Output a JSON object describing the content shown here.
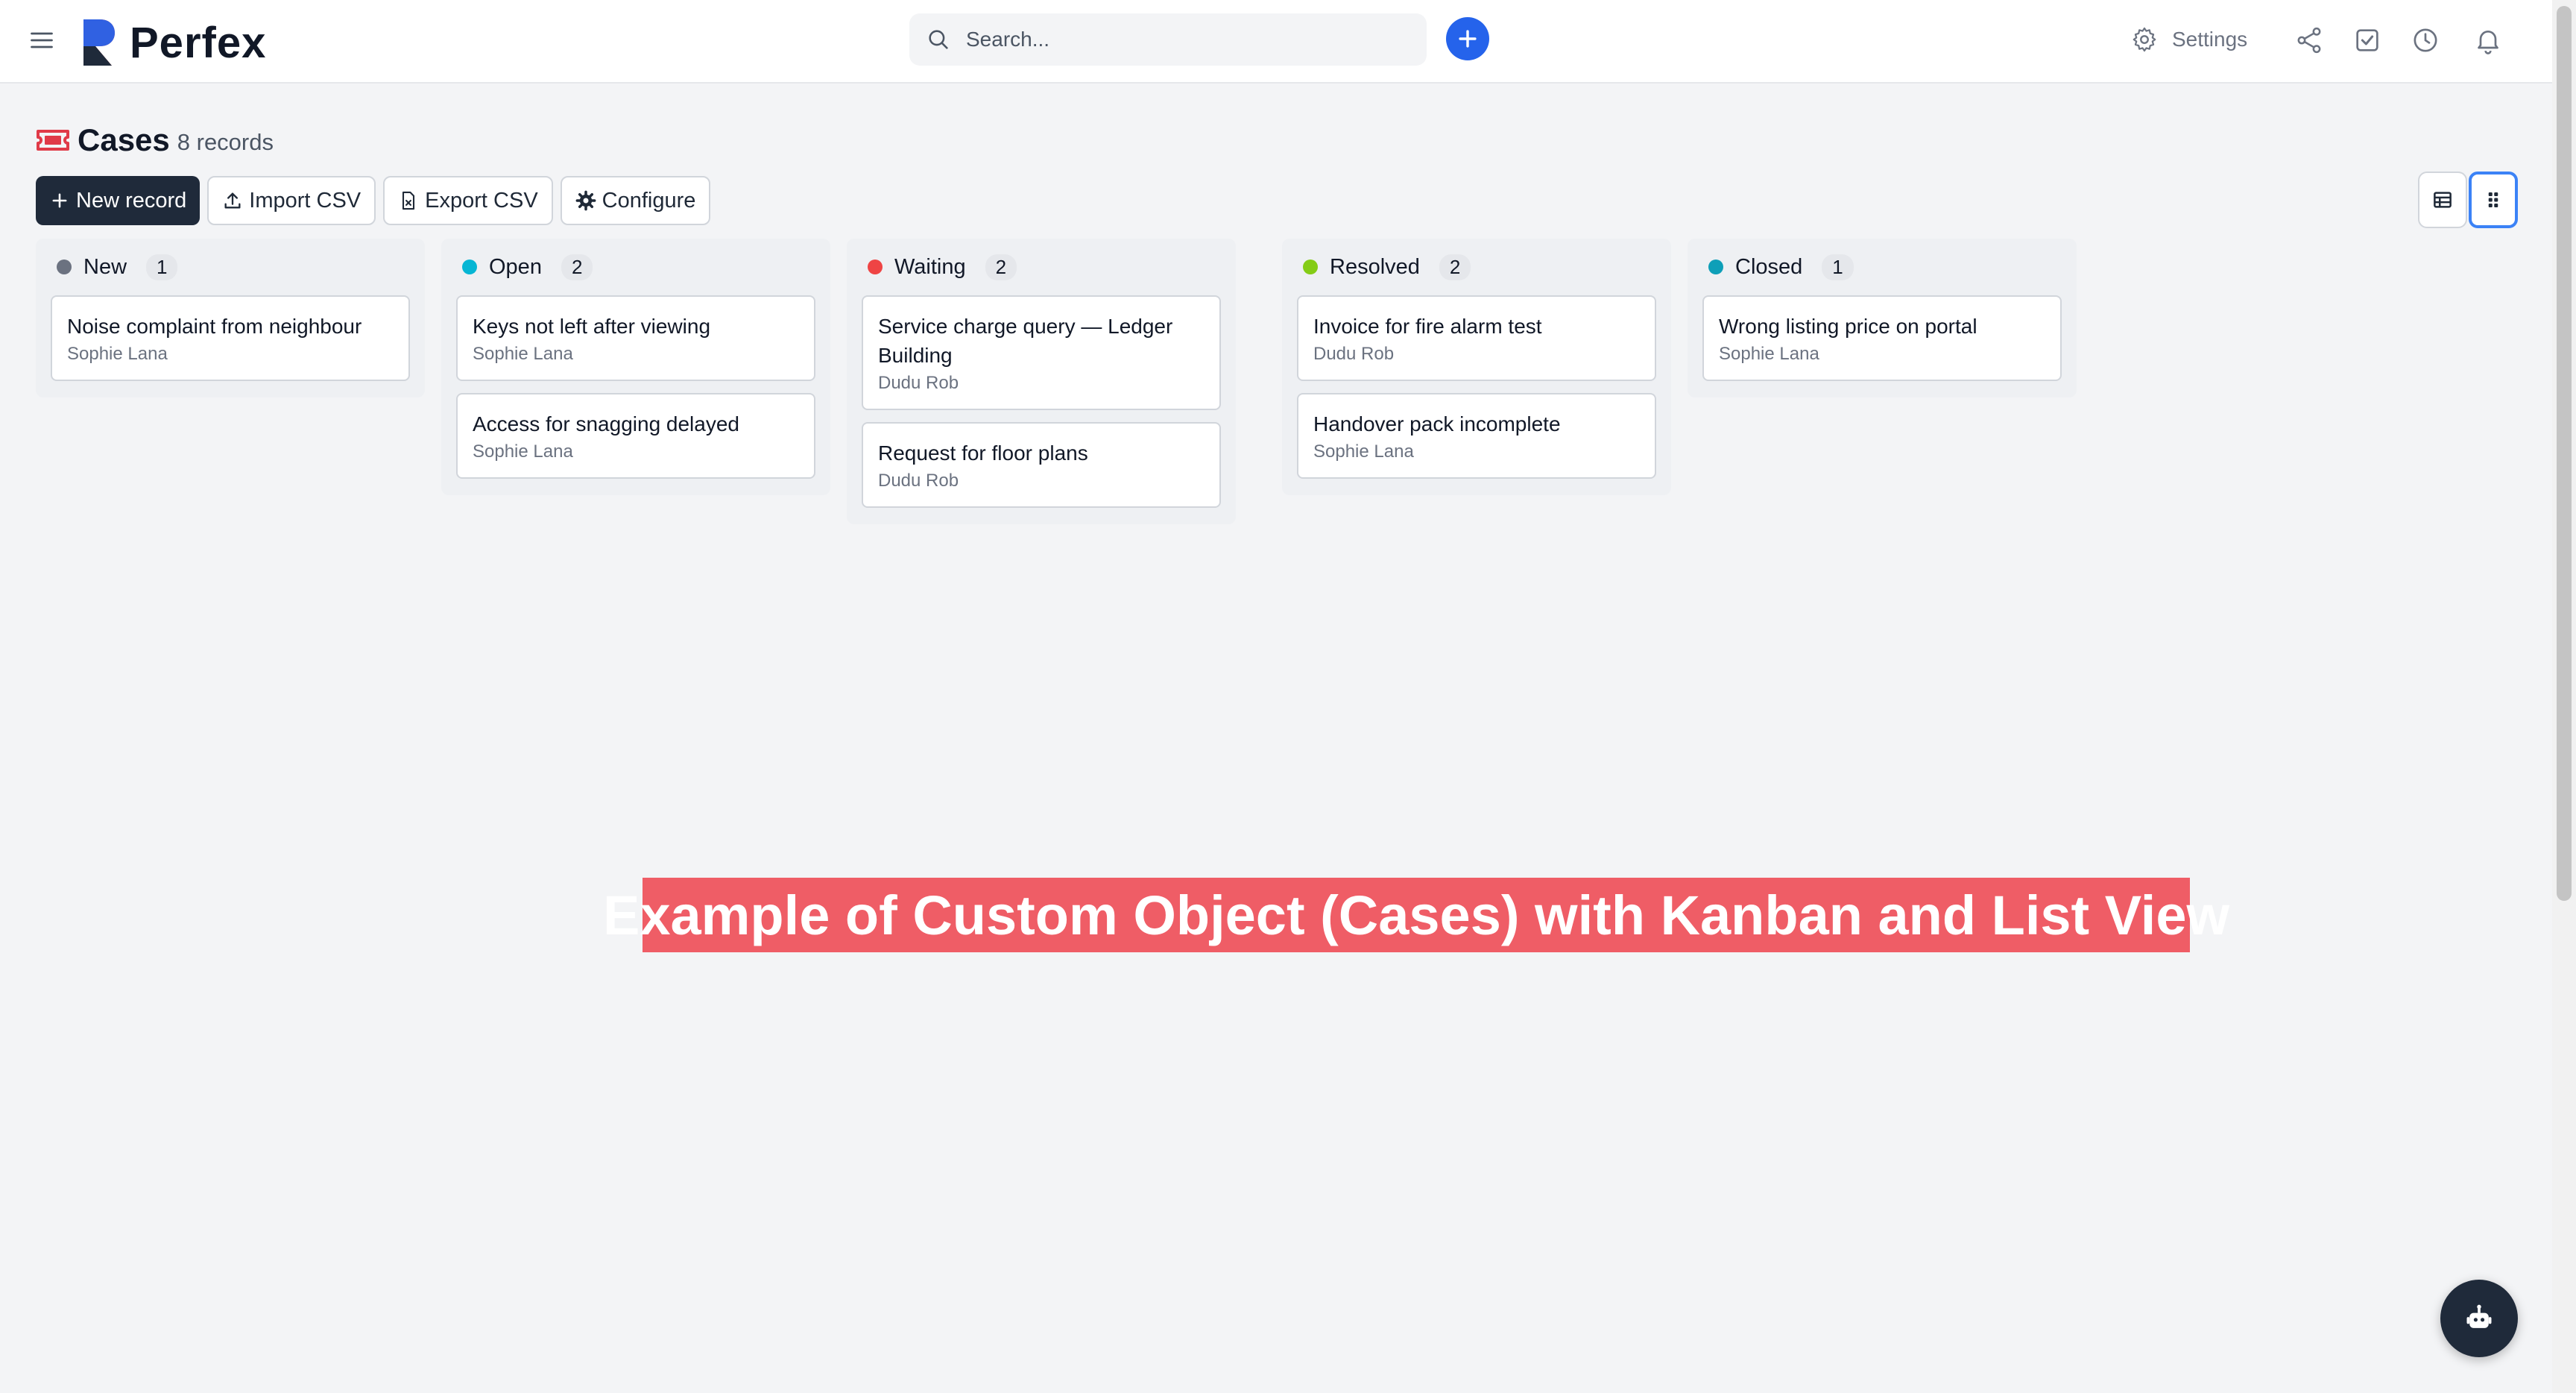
{
  "app": {
    "brand": "Perfex"
  },
  "search": {
    "placeholder": "Search..."
  },
  "topbar": {
    "settings_label": "Settings"
  },
  "page": {
    "title": "Cases",
    "record_count": "8 records"
  },
  "toolbar": {
    "new_record": "New record",
    "import_csv": "Import CSV",
    "export_csv": "Export CSV",
    "configure": "Configure"
  },
  "colors": {
    "new": "#6b7280",
    "open": "#06b6d4",
    "waiting": "#ef4444",
    "resolved": "#84cc16",
    "closed": "#0e9fb8",
    "accent": "#2563eb",
    "banner": "#ef5d66"
  },
  "columns": [
    {
      "name": "New",
      "count": "1",
      "cards": [
        {
          "title": "Noise complaint from neighbour",
          "assignee": "Sophie Lana"
        }
      ]
    },
    {
      "name": "Open",
      "count": "2",
      "cards": [
        {
          "title": "Keys not left after viewing",
          "assignee": "Sophie Lana"
        },
        {
          "title": "Access for snagging delayed",
          "assignee": "Sophie Lana"
        }
      ]
    },
    {
      "name": "Waiting",
      "count": "2",
      "cards": [
        {
          "title": "Service charge query — Ledger Building",
          "assignee": "Dudu Rob"
        },
        {
          "title": "Request for floor plans",
          "assignee": "Dudu Rob"
        }
      ]
    },
    {
      "name": "Resolved",
      "count": "2",
      "cards": [
        {
          "title": "Invoice for fire alarm test",
          "assignee": "Dudu Rob"
        },
        {
          "title": "Handover pack incomplete",
          "assignee": "Sophie Lana"
        }
      ]
    },
    {
      "name": "Closed",
      "count": "1",
      "cards": [
        {
          "title": "Wrong listing price on portal",
          "assignee": "Sophie Lana"
        }
      ]
    }
  ],
  "banner": {
    "text": "Example of Custom Object (Cases) with Kanban and List View"
  }
}
